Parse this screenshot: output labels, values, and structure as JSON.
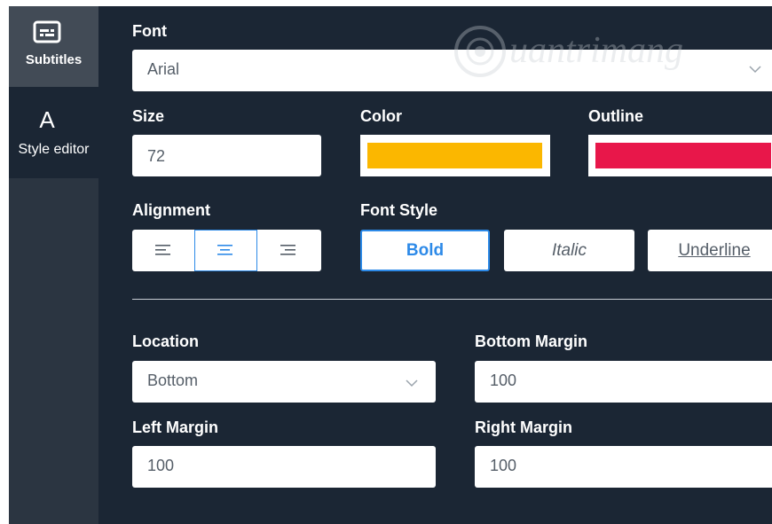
{
  "sidebar": {
    "items": [
      {
        "label": "Subtitles",
        "icon": "subtitles-icon",
        "active": true
      },
      {
        "label": "Style editor",
        "icon": "letter-a-icon",
        "active": false
      }
    ]
  },
  "font": {
    "label": "Font",
    "value": "Arial"
  },
  "size": {
    "label": "Size",
    "value": "72"
  },
  "color": {
    "label": "Color",
    "swatch": "#fbb700"
  },
  "outline": {
    "label": "Outline",
    "swatch": "#e8174a"
  },
  "alignment": {
    "label": "Alignment",
    "options": [
      "align-left",
      "align-center",
      "align-right"
    ],
    "selected": "align-center"
  },
  "font_style": {
    "label": "Font Style",
    "bold": "Bold",
    "italic": "Italic",
    "underline": "Underline",
    "selected": "Bold"
  },
  "location": {
    "label": "Location",
    "value": "Bottom"
  },
  "bottom_margin": {
    "label": "Bottom Margin",
    "value": "100"
  },
  "left_margin": {
    "label": "Left Margin",
    "value": "100"
  },
  "right_margin": {
    "label": "Right Margin",
    "value": "100"
  },
  "watermark": {
    "text": "uantrimang"
  },
  "colors": {
    "background": "#1b2634",
    "sidebar": "#2b3541",
    "sidebar_active": "#424b56",
    "accent": "#2d8ae8"
  }
}
